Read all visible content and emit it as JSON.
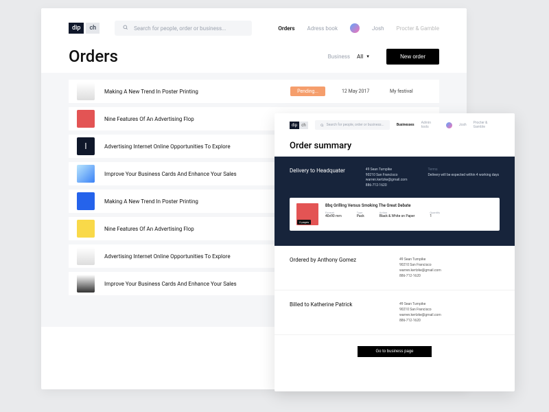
{
  "logo": {
    "left": "dip",
    "right": "ch"
  },
  "search": {
    "placeholder": "Search for people, order or business..."
  },
  "nav": {
    "orders": "Orders",
    "adress": "Adress book",
    "user": "Josh",
    "company": "Procter & Gamble"
  },
  "page": {
    "title": "Orders",
    "filter_label": "Business",
    "filter_value": "All",
    "new_btn": "New order"
  },
  "orders": {
    "r0": {
      "title": "Making A New Trend In Poster Printing",
      "status": "Pending...",
      "date": "12 May 2017",
      "context": "My festival"
    },
    "r1": {
      "title": "Nine Features Of An Advertising Flop"
    },
    "r2": {
      "title": "Advertising Internet Online Opportunities To Explore"
    },
    "r3": {
      "title": "Improve Your Business Cards And Enhance Your Sales"
    },
    "r4": {
      "title": "Making A New Trend In Poster Printing"
    },
    "r5": {
      "title": "Nine Features Of An Advertising Flop"
    },
    "r6": {
      "title": "Advertising Internet Online Opportunities To Explore"
    },
    "r7": {
      "title": "Improve Your Business Cards And Enhance Your Sales"
    }
  },
  "summary": {
    "search_placeholder": "Search for people, order or business...",
    "nav": {
      "businesses": "Businesses",
      "admin": "Admin tools",
      "user": "Josh",
      "company": "Procter & Gamble"
    },
    "title": "Order summary",
    "delivery": {
      "heading": "Delivery to Headquater",
      "line1": "49 Sean Turnpike",
      "line2": "90210 San Francisco",
      "line3": "warren.kertzke@gmail.com",
      "line4": "886-712-1620",
      "terms_label": "Terms",
      "terms_text": "Delivery will be expected within 4 working days"
    },
    "item": {
      "title": "Bbq Grilling Versus Smoking The Great Debate",
      "pages_badge": "2 pages",
      "format_lbl": "Format",
      "format_val": "40x90 mm",
      "type_lbl": "Type",
      "type_val": "Pack",
      "action_lbl": "Action",
      "action_val": "Black & White on Paper",
      "qty_lbl": "Quantity",
      "qty_val": "1"
    },
    "ordered": {
      "heading": "Ordered by Anthony Gomez",
      "l1": "49 Sean Turnpike",
      "l2": "90210 San Francisco",
      "l3": "warren.kertzke@gmail.com",
      "l4": "886-712-1620"
    },
    "billed": {
      "heading": "Billed to Katherine Patrick",
      "l1": "49 Sean Turnpike",
      "l2": "90210 San Francisco",
      "l3": "warren.kertzke@gmail.com",
      "l4": "886-712-1620"
    },
    "footer_btn": "Go to business page"
  }
}
